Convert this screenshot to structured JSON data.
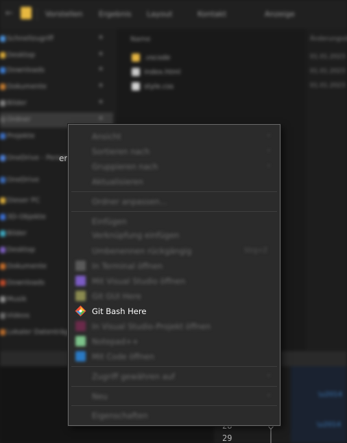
{
  "titlebar": {
    "back_glyph": "←",
    "tabs": [
      "Vorstellen",
      "Ergebnis",
      "Layout",
      "Kontakt",
      "Anzeige"
    ]
  },
  "sidebar": {
    "items": [
      {
        "label": "Schnellzugriff",
        "color": "#4a8fd8",
        "pin": "★"
      },
      {
        "label": "Desktop",
        "color": "#d8a938",
        "pin": "★"
      },
      {
        "label": "Downloads",
        "color": "#3c7bd0",
        "pin": "★"
      },
      {
        "label": "Dokumente",
        "color": "#c07a30",
        "pin": "★"
      },
      {
        "label": "Bilder",
        "color": "#7e7e7e",
        "pin": "★"
      },
      {
        "label": "Ordner",
        "color": "#5a5a5a",
        "pin": "★",
        "selected": true
      },
      {
        "label": "Projekte",
        "color": "#3d6fc0",
        "pin": ""
      },
      {
        "label": "OneDrive - Personal",
        "color": "#4d7fd6",
        "pin": ""
      },
      {
        "label": "OneDrive",
        "color": "#3a6ab8",
        "pin": ""
      },
      {
        "label": "Dieser PC",
        "color": "#d7aa3b",
        "pin": ""
      },
      {
        "label": "3D-Objekte",
        "color": "#3c6fd2",
        "pin": ""
      },
      {
        "label": "Bilder",
        "color": "#3eaac2",
        "pin": ""
      },
      {
        "label": "Desktop",
        "color": "#7d5fc0",
        "pin": ""
      },
      {
        "label": "Dokumente",
        "color": "#c46d2b",
        "pin": ""
      },
      {
        "label": "Downloads",
        "color": "#bf4a2a",
        "pin": ""
      },
      {
        "label": "Musik",
        "color": "#8c8c8c",
        "pin": ""
      },
      {
        "label": "Videos",
        "color": "#6a6a6a",
        "pin": ""
      },
      {
        "label": "Lokaler Datenträger (C:)",
        "color": "#b56a2c",
        "pin": ""
      }
    ]
  },
  "main": {
    "header": "Name",
    "files": [
      {
        "name": ".vscode",
        "color": "#e3b341"
      },
      {
        "name": "index.html",
        "color": "#c9c9c9"
      },
      {
        "name": "style.css",
        "color": "#d3d3d3"
      }
    ]
  },
  "right_pane": {
    "header": "Änderungsdatum",
    "lines": [
      "01.01.2023",
      "01.01.2023",
      "01.01.2023"
    ]
  },
  "stray_text": "er",
  "editor": {
    "line_numbers": [
      "28",
      "29"
    ]
  },
  "context_menu": {
    "items": [
      {
        "type": "item",
        "label": "Ansicht",
        "arrow": "›",
        "icon": ""
      },
      {
        "type": "item",
        "label": "Sortieren nach",
        "arrow": "›",
        "icon": ""
      },
      {
        "type": "item",
        "label": "Gruppieren nach",
        "arrow": "›",
        "icon": ""
      },
      {
        "type": "item",
        "label": "Aktualisieren",
        "arrow": "",
        "icon": ""
      },
      {
        "type": "sep"
      },
      {
        "type": "item",
        "label": "Ordner anpassen...",
        "arrow": "",
        "icon": ""
      },
      {
        "type": "sep"
      },
      {
        "type": "item",
        "label": "Einfügen",
        "arrow": "",
        "icon": ""
      },
      {
        "type": "item",
        "label": "Verknüpfung einfügen",
        "arrow": "",
        "icon": ""
      },
      {
        "type": "item",
        "label": "Umbenennen rückgängig",
        "shortcut": "Strg+Z",
        "arrow": "",
        "icon": ""
      },
      {
        "type": "item",
        "label": "In Terminal öffnen",
        "arrow": "",
        "icon": "#5a5a5a"
      },
      {
        "type": "item",
        "label": "Mit Visual Studio öffnen",
        "arrow": "",
        "icon": "#7b5cc4"
      },
      {
        "type": "item",
        "label": "Git GUI Here",
        "arrow": "",
        "icon": "#8a8a50"
      },
      {
        "type": "item",
        "label": "Git Bash Here",
        "arrow": "",
        "icon": "gitbash",
        "sharp": true
      },
      {
        "type": "item",
        "label": "In Visual Studio-Projekt öffnen",
        "arrow": "",
        "icon": "#6a2a4a"
      },
      {
        "type": "item",
        "label": "Notepad++",
        "arrow": "",
        "icon": "#7cc28a"
      },
      {
        "type": "item",
        "label": "Mit Code öffnen",
        "arrow": "",
        "icon": "#2a7ac4"
      },
      {
        "type": "sep"
      },
      {
        "type": "item",
        "label": "Zugriff gewähren auf",
        "arrow": "›",
        "icon": ""
      },
      {
        "type": "sep"
      },
      {
        "type": "item",
        "label": "Neu",
        "arrow": "›",
        "icon": ""
      },
      {
        "type": "sep"
      },
      {
        "type": "item",
        "label": "Eigenschaften",
        "arrow": "",
        "icon": ""
      }
    ]
  }
}
